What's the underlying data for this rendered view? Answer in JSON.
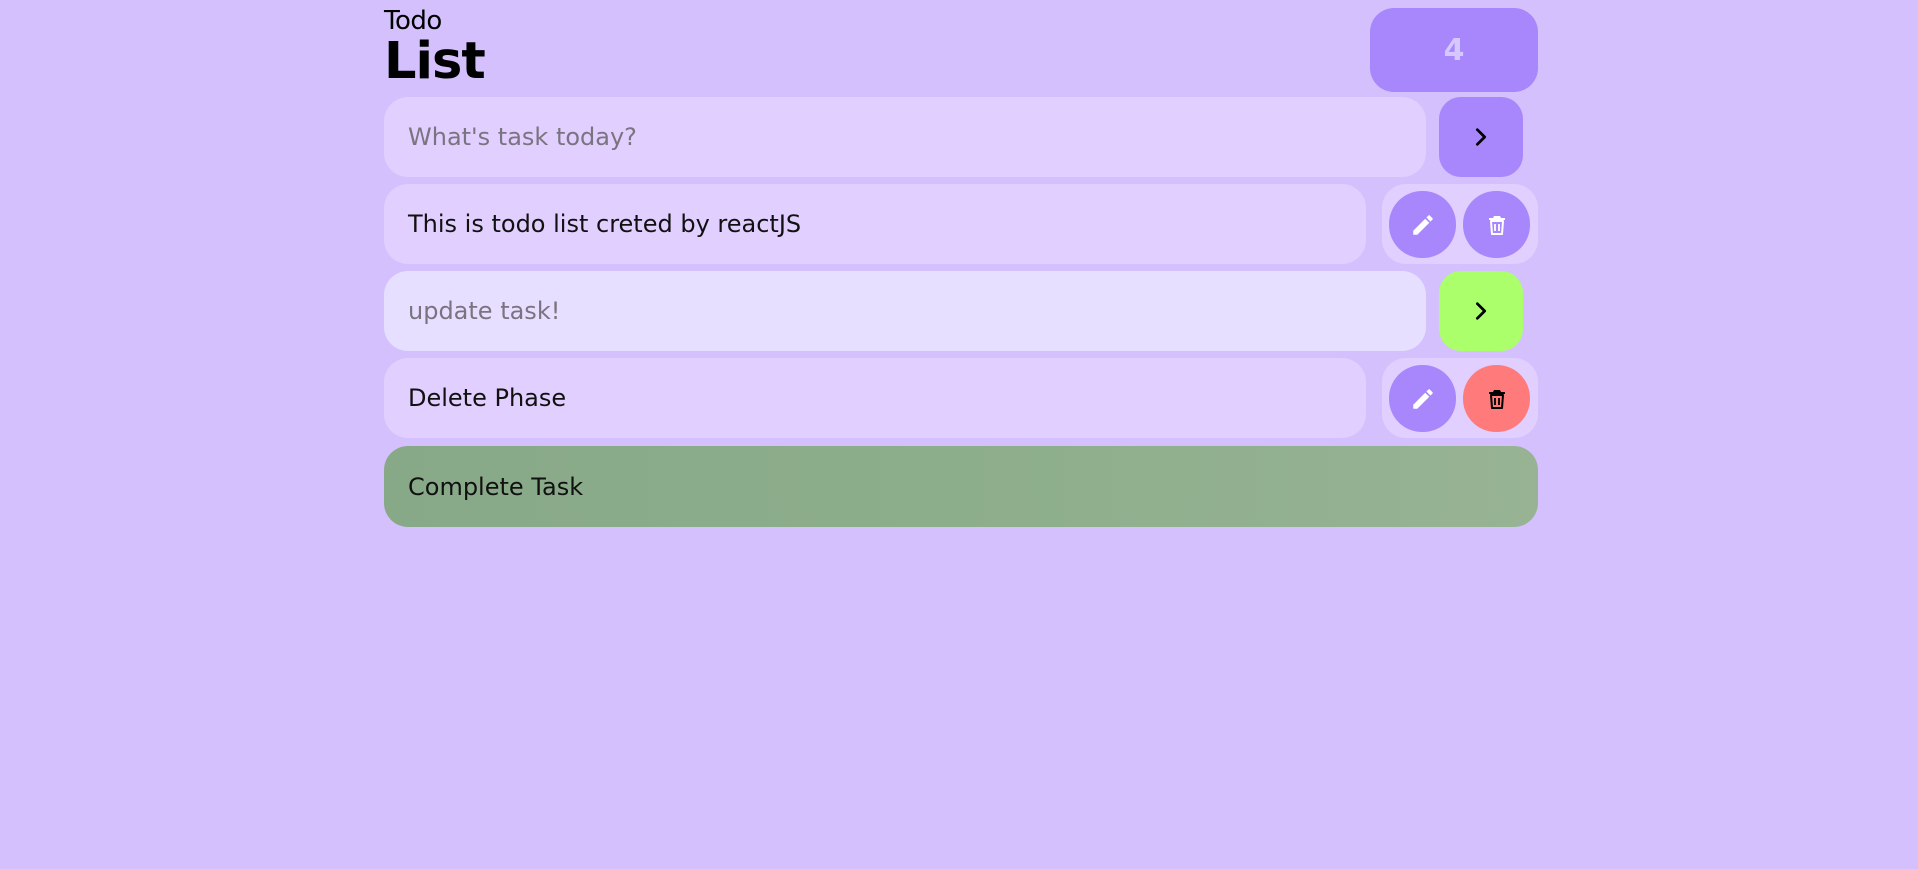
{
  "header": {
    "title_small": "Todo",
    "title_big": "List",
    "count": "4"
  },
  "new_task": {
    "placeholder": "What's task today?",
    "submit_icon": "chevron-right-icon"
  },
  "tasks": [
    {
      "text": "This is todo list creted by reactJS",
      "edit_icon": "pencil-icon",
      "delete_icon": "trash-icon"
    },
    {
      "text": "Delete Phase",
      "edit_icon": "pencil-icon",
      "delete_icon": "trash-icon"
    }
  ],
  "update_task": {
    "placeholder": "update task!",
    "submit_icon": "chevron-right-icon"
  },
  "completed_task": {
    "text": "Complete Task"
  },
  "colors": {
    "background": "#d4c0fd",
    "accent": "#a886fc",
    "field": "#e1cfff",
    "update_submit": "#aaff6b",
    "delete_active": "#ff7b7b",
    "completed": "#8dae8b"
  }
}
